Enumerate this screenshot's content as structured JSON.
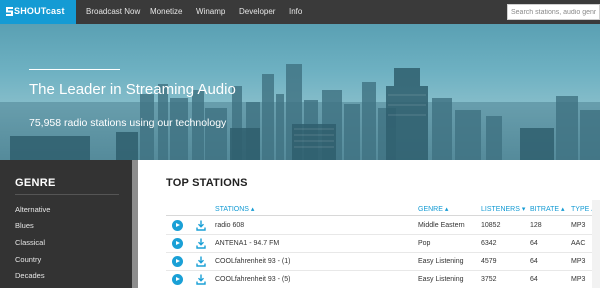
{
  "nav": {
    "logo_text": "SHOUTcast",
    "items": [
      "Broadcast Now",
      "Monetize",
      "Winamp",
      "Developer",
      "Info"
    ],
    "search_placeholder": "Search stations, audio genres..."
  },
  "hero": {
    "title": "The Leader in Streaming Audio",
    "subtitle": "75,958 radio stations using our technology"
  },
  "sidebar": {
    "title": "GENRE",
    "items": [
      "Alternative",
      "Blues",
      "Classical",
      "Country",
      "Decades"
    ]
  },
  "main": {
    "title": "TOP STATIONS",
    "columns": {
      "stations": "STATIONS ▴",
      "genre": "GENRE ▴",
      "listeners": "LISTENERS ▾",
      "bitrate": "BITRATE ▴",
      "type": "TYPE ▴"
    },
    "rows": [
      {
        "station": "radio 608",
        "genre": "Middle Eastern",
        "listeners": "10852",
        "bitrate": "128",
        "type": "MP3"
      },
      {
        "station": "ANTENA1 - 94.7 FM",
        "genre": "Pop",
        "listeners": "6342",
        "bitrate": "64",
        "type": "AAC"
      },
      {
        "station": "COOLfahrenheit 93 - (1)",
        "genre": "Easy Listening",
        "listeners": "4579",
        "bitrate": "64",
        "type": "MP3"
      },
      {
        "station": "COOLfahrenheit 93 - (5)",
        "genre": "Easy Listening",
        "listeners": "3752",
        "bitrate": "64",
        "type": "MP3"
      }
    ]
  },
  "colors": {
    "brand": "#149bd4",
    "nav_bg": "#3a3a3a",
    "sidebar_bg": "#333333"
  },
  "icons": {
    "play": "play-icon",
    "download": "download-icon"
  }
}
